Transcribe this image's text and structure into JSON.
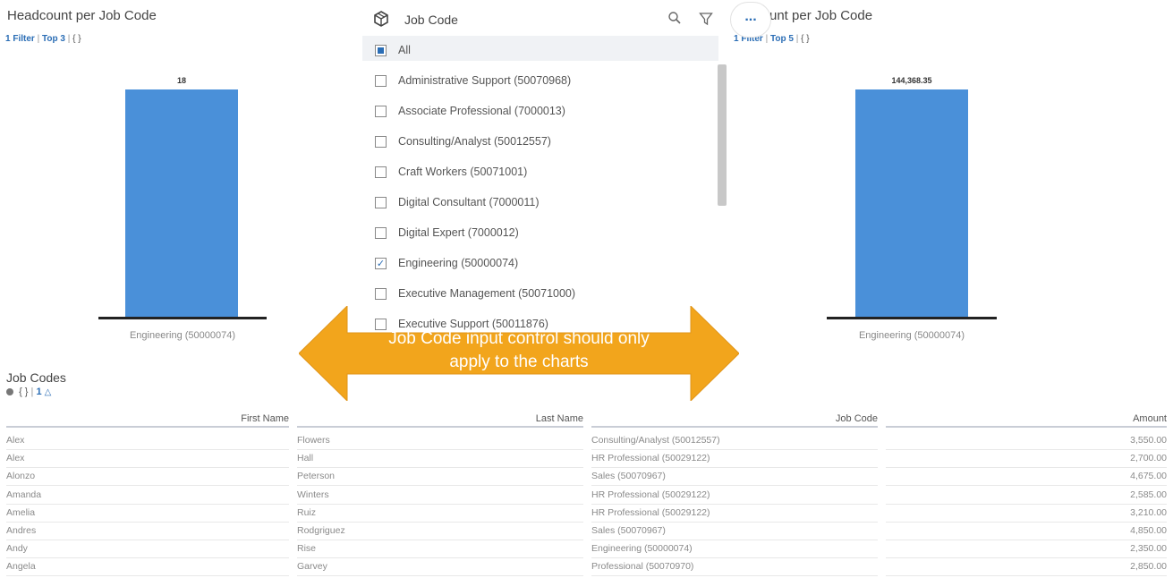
{
  "left_chart": {
    "title": "Headcount per Job Code",
    "filter_label": "1 Filter",
    "top_label": "Top 3",
    "braces": "{ }",
    "value_label": "18",
    "category_label": "Engineering (50000074)"
  },
  "right_chart": {
    "title_visible": "unt per Job Code",
    "filter_label": "1 Filter",
    "top_label": "Top 5",
    "braces": "{ }",
    "value_label": "144,368.35",
    "category_label": "Engineering (50000074)"
  },
  "chart_data": [
    {
      "type": "bar",
      "title": "Headcount per Job Code",
      "categories": [
        "Engineering (50000074)"
      ],
      "values": [
        18
      ]
    },
    {
      "type": "bar",
      "title": "unt per Job Code",
      "categories": [
        "Engineering (50000074)"
      ],
      "values": [
        144368.35
      ]
    }
  ],
  "dropdown": {
    "title": "Job Code",
    "items": [
      {
        "label": "All",
        "state": "partial"
      },
      {
        "label": "Administrative Support (50070968)",
        "state": "unchecked"
      },
      {
        "label": "Associate Professional (7000013)",
        "state": "unchecked"
      },
      {
        "label": "Consulting/Analyst (50012557)",
        "state": "unchecked"
      },
      {
        "label": "Craft Workers (50071001)",
        "state": "unchecked"
      },
      {
        "label": "Digital Consultant (7000011)",
        "state": "unchecked"
      },
      {
        "label": "Digital Expert (7000012)",
        "state": "unchecked"
      },
      {
        "label": "Engineering (50000074)",
        "state": "checked"
      },
      {
        "label": "Executive Management (50071000)",
        "state": "unchecked"
      },
      {
        "label": "Executive Support (50011876)",
        "state": "unchecked"
      }
    ],
    "icons": [
      "cube-icon",
      "search-icon",
      "filter-icon",
      "more-icon"
    ],
    "more_label": "..."
  },
  "annotation": {
    "text_line1": "Job Code input control should only",
    "text_line2": "apply to the charts",
    "color": "#f2a51c"
  },
  "table": {
    "title": "Job Codes",
    "toolbar_braces": "{ }",
    "toolbar_count": "1",
    "columns": [
      "First Name",
      "Last Name",
      "Job Code",
      "Amount"
    ],
    "rows": [
      [
        "Alex",
        "Flowers",
        "Consulting/Analyst (50012557)",
        "3,550.00"
      ],
      [
        "Alex",
        "Hall",
        "HR Professional (50029122)",
        "2,700.00"
      ],
      [
        "Alonzo",
        "Peterson",
        "Sales (50070967)",
        "4,675.00"
      ],
      [
        "Amanda",
        "Winters",
        "HR Professional (50029122)",
        "2,585.00"
      ],
      [
        "Amelia",
        "Ruiz",
        "HR Professional (50029122)",
        "3,210.00"
      ],
      [
        "Andres",
        "Rodgriguez",
        "Sales (50070967)",
        "4,850.00"
      ],
      [
        "Andy",
        "Rise",
        "Engineering (50000074)",
        "2,350.00"
      ],
      [
        "Angela",
        "Garvey",
        "Professional (50070970)",
        "2,850.00"
      ]
    ]
  },
  "colors": {
    "bar": "#4a90d9",
    "link": "#2a6db5"
  }
}
